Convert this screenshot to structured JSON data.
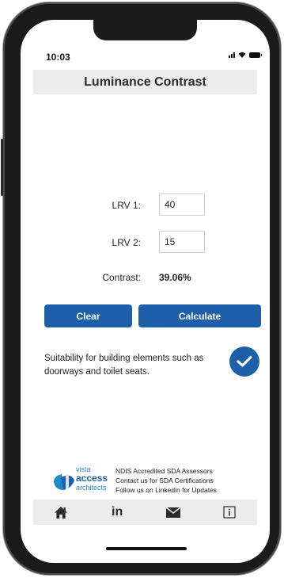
{
  "status": {
    "time": "10:03"
  },
  "header": {
    "title": "Luminance Contrast"
  },
  "form": {
    "lrv1": {
      "label": "LRV 1:",
      "value": "40"
    },
    "lrv2": {
      "label": "LRV 2:",
      "value": "15"
    },
    "contrast": {
      "label": "Contrast:",
      "value": "39.06%"
    }
  },
  "actions": {
    "clear_label": "Clear",
    "calculate_label": "Calculate"
  },
  "result": {
    "suitability_text": "Suitability for building elements such as doorways and toilet seats.",
    "status_icon": "check-circle-icon"
  },
  "footer": {
    "logo": {
      "line1": "vista",
      "line2": "access",
      "line3": "architects"
    },
    "lines": [
      "NDIS Accredited SDA Assessors",
      "Contact us for SDA Certifications",
      "Follow us on Linkedin for Updates"
    ]
  },
  "nav": {
    "items": [
      {
        "icon": "home-icon"
      },
      {
        "icon": "linkedin-icon",
        "label": "in"
      },
      {
        "icon": "mail-icon"
      },
      {
        "icon": "info-icon"
      }
    ]
  },
  "colors": {
    "accent": "#1e5fa9",
    "bar": "#ececec"
  }
}
